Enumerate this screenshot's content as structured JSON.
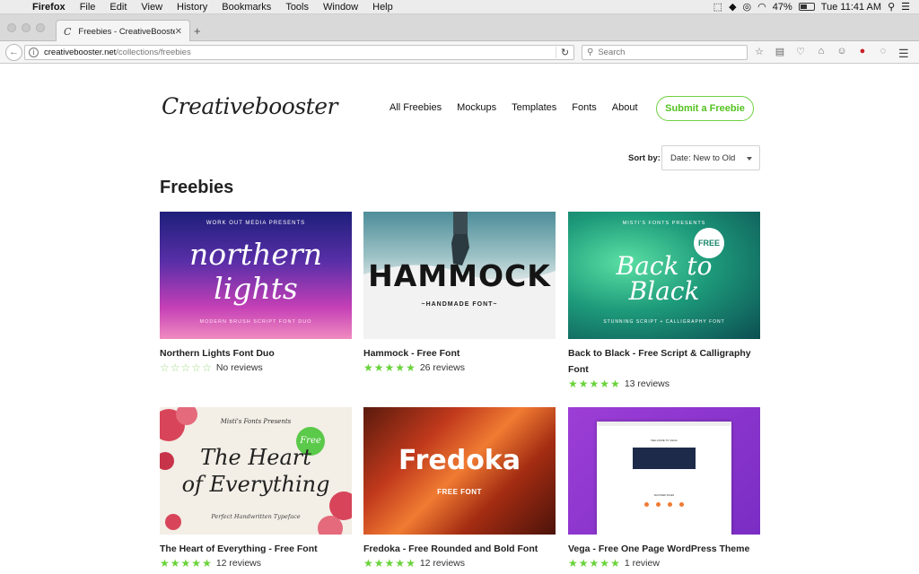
{
  "menubar": {
    "app": "Firefox",
    "items": [
      "File",
      "Edit",
      "View",
      "History",
      "Bookmarks",
      "Tools",
      "Window",
      "Help"
    ],
    "battery": "47%",
    "clock": "Tue 11:41 AM"
  },
  "browser": {
    "tab_title": "Freebies - CreativeBooster",
    "url_host": "creativebooster.net",
    "url_path": "/collections/freebies",
    "search_placeholder": "Search"
  },
  "site": {
    "logo": "Creativebooster",
    "nav": [
      "All Freebies",
      "Mockups",
      "Templates",
      "Fonts",
      "About"
    ],
    "submit_label": "Submit a Freebie",
    "sort_label": "Sort by:",
    "sort_value": "Date: New to Old",
    "heading": "Freebies"
  },
  "cards": [
    {
      "title": "Northern Lights Font Duo",
      "rating": 0,
      "reviews": "No reviews",
      "thumb": {
        "top": "WORK OUT MEDIA PRESENTS",
        "main1": "northern",
        "main2": "lights",
        "bottom": "MODERN BRUSH SCRIPT FONT DUO"
      }
    },
    {
      "title": "Hammock - Free Font",
      "rating": 5,
      "reviews": "26 reviews",
      "thumb": {
        "main": "HAMMOCK",
        "bottom": "~HANDMADE FONT~"
      }
    },
    {
      "title": "Back to Black - Free Script & Calligraphy Font",
      "rating": 5,
      "reviews": "13 reviews",
      "thumb": {
        "top": "MISTI'S FONTS PRESENTS",
        "badge": "FREE",
        "main1": "Back to",
        "main2": "Black",
        "bottom": "STUNNING SCRIPT + CALLIGRAPHY FONT"
      }
    },
    {
      "title": "The Heart of Everything - Free Font",
      "rating": 5,
      "reviews": "12 reviews",
      "thumb": {
        "top": "Misti's Fonts Presents",
        "badge": "Free",
        "main1": "The Heart",
        "main2": "of Everything",
        "bottom": "Perfect Handwritten Typeface"
      }
    },
    {
      "title": "Fredoka - Free Rounded and Bold Font",
      "rating": 5,
      "reviews": "12 reviews",
      "thumb": {
        "main": "Fredoka",
        "bottom": "FREE FONT"
      }
    },
    {
      "title": "Vega - Free One Page WordPress Theme",
      "rating": 5,
      "reviews": "1 review",
      "thumb": {
        "mini_heading": "WELCOME TO VEGA",
        "mini_section": "FEATURED PAGES"
      }
    }
  ]
}
